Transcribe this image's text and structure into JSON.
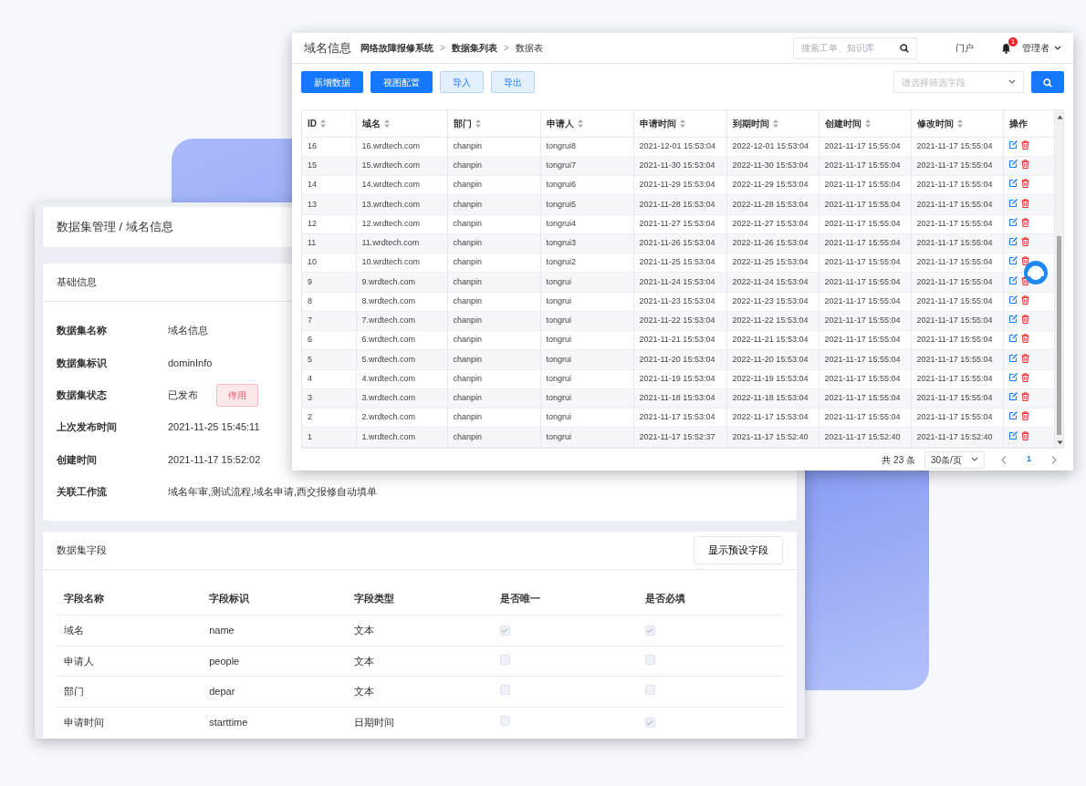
{
  "back_window": {
    "breadcrumb": "数据集管理 / 域名信息",
    "info_card": {
      "title": "基础信息",
      "fields": [
        {
          "label": "数据集名称",
          "value": "域名信息"
        },
        {
          "label": "数据集标识",
          "value": "dominInfo"
        },
        {
          "label": "数据集状态",
          "value": "已发布",
          "action": "停用"
        },
        {
          "label": "上次发布时间",
          "value": "2021-11-25 15:45:11"
        },
        {
          "label": "创建时间",
          "value": "2021-11-17 15:52:02"
        },
        {
          "label": "关联工作流",
          "value": "域名年审,测试流程,域名申请,西交报修自动填单"
        }
      ]
    },
    "fields_card": {
      "title": "数据集字段",
      "button": "显示预设字段",
      "columns": [
        "字段名称",
        "字段标识",
        "字段类型",
        "是否唯一",
        "是否必填"
      ],
      "rows": [
        {
          "name": "域名",
          "key": "name",
          "type": "文本",
          "unique": true,
          "required": true
        },
        {
          "name": "申请人",
          "key": "people",
          "type": "文本",
          "unique": false,
          "required": false
        },
        {
          "name": "部门",
          "key": "depar",
          "type": "文本",
          "unique": false,
          "required": false
        },
        {
          "name": "申请时间",
          "key": "starttime",
          "type": "日期时间",
          "unique": false,
          "required": true
        }
      ]
    }
  },
  "front_window": {
    "title": "域名信息",
    "breadcrumb": [
      "网络故障报修系统",
      "数据集列表",
      "数据表"
    ],
    "breadcrumb_separator": ">",
    "search": {
      "placeholder": "搜索工单、知识库"
    },
    "portal": "门户",
    "notifications": "1",
    "user": "管理者",
    "toolbar": {
      "buttons": [
        {
          "label": "新增数据",
          "kind": "primary"
        },
        {
          "label": "视图配置",
          "kind": "primary"
        },
        {
          "label": "导入",
          "kind": "light"
        },
        {
          "label": "导出",
          "kind": "light"
        }
      ],
      "filter": {
        "placeholder": "请选择筛选字段"
      }
    },
    "table": {
      "columns": [
        {
          "label": "ID",
          "sortable": true
        },
        {
          "label": "域名",
          "sortable": true
        },
        {
          "label": "部门",
          "sortable": true
        },
        {
          "label": "申请人",
          "sortable": true
        },
        {
          "label": "申请时间",
          "sortable": true
        },
        {
          "label": "到期时间",
          "sortable": true
        },
        {
          "label": "创建时间",
          "sortable": true
        },
        {
          "label": "修改时间",
          "sortable": true
        },
        {
          "label": "操作",
          "sortable": false
        }
      ],
      "rows": [
        [
          "16",
          "16.wrdtech.com",
          "chanpin",
          "tongrui8",
          "2021-12-01 15:53:04",
          "2022-12-01 15:53:04",
          "2021-11-17 15:55:04",
          "2021-11-17 15:55:04"
        ],
        [
          "15",
          "15.wrdtech.com",
          "chanpin",
          "tongrui7",
          "2021-11-30 15:53:04",
          "2022-11-30 15:53:04",
          "2021-11-17 15:55:04",
          "2021-11-17 15:55:04"
        ],
        [
          "14",
          "14.wrdtech.com",
          "chanpin",
          "tongrui6",
          "2021-11-29 15:53:04",
          "2022-11-29 15:53:04",
          "2021-11-17 15:55:04",
          "2021-11-17 15:55:04"
        ],
        [
          "13",
          "13.wrdtech.com",
          "chanpin",
          "tongrui5",
          "2021-11-28 15:53:04",
          "2022-11-28 15:53:04",
          "2021-11-17 15:55:04",
          "2021-11-17 15:55:04"
        ],
        [
          "12",
          "12.wrdtech.com",
          "chanpin",
          "tongrui4",
          "2021-11-27 15:53:04",
          "2022-11-27 15:53:04",
          "2021-11-17 15:55:04",
          "2021-11-17 15:55:04"
        ],
        [
          "11",
          "11.wrdtech.com",
          "chanpin",
          "tongrui3",
          "2021-11-26 15:53:04",
          "2022-11-26 15:53:04",
          "2021-11-17 15:55:04",
          "2021-11-17 15:55:04"
        ],
        [
          "10",
          "10.wrdtech.com",
          "chanpin",
          "tongrui2",
          "2021-11-25 15:53:04",
          "2022-11-25 15:53:04",
          "2021-11-17 15:55:04",
          "2021-11-17 15:55:04"
        ],
        [
          "9",
          "9.wrdtech.com",
          "chanpin",
          "tongrui",
          "2021-11-24 15:53:04",
          "2022-11-24 15:53:04",
          "2021-11-17 15:55:04",
          "2021-11-17 15:55:04"
        ],
        [
          "8",
          "8.wrdtech.com",
          "chanpin",
          "tongrui",
          "2021-11-23 15:53:04",
          "2022-11-23 15:53:04",
          "2021-11-17 15:55:04",
          "2021-11-17 15:55:04"
        ],
        [
          "7",
          "7.wrdtech.com",
          "chanpin",
          "tongrui",
          "2021-11-22 15:53:04",
          "2022-11-22 15:53:04",
          "2021-11-17 15:55:04",
          "2021-11-17 15:55:04"
        ],
        [
          "6",
          "6.wrdtech.com",
          "chanpin",
          "tongrui",
          "2021-11-21 15:53:04",
          "2022-11-21 15:53:04",
          "2021-11-17 15:55:04",
          "2021-11-17 15:55:04"
        ],
        [
          "5",
          "5.wrdtech.com",
          "chanpin",
          "tongrui",
          "2021-11-20 15:53:04",
          "2022-11-20 15:53:04",
          "2021-11-17 15:55:04",
          "2021-11-17 15:55:04"
        ],
        [
          "4",
          "4.wrdtech.com",
          "chanpin",
          "tongrui",
          "2021-11-19 15:53:04",
          "2022-11-19 15:53:04",
          "2021-11-17 15:55:04",
          "2021-11-17 15:55:04"
        ],
        [
          "3",
          "3.wrdtech.com",
          "chanpin",
          "tongrui",
          "2021-11-18 15:53:04",
          "2022-11-18 15:53:04",
          "2021-11-17 15:55:04",
          "2021-11-17 15:55:04"
        ],
        [
          "2",
          "2.wrdtech.com",
          "chanpin",
          "tongrui",
          "2021-11-17 15:53:04",
          "2022-11-17 15:53:04",
          "2021-11-17 15:55:04",
          "2021-11-17 15:55:04"
        ],
        [
          "1",
          "1.wrdtech.com",
          "chanpin",
          "tongrui",
          "2021-11-17 15:52:37",
          "2021-11-17 15:52:40",
          "2021-11-17 15:52:40",
          "2021-11-17 15:52:40"
        ]
      ]
    },
    "pagination": {
      "total": "共 23 条",
      "page_size": "30条/页",
      "pages": [
        {
          "label": "1",
          "selected": true
        }
      ]
    }
  }
}
